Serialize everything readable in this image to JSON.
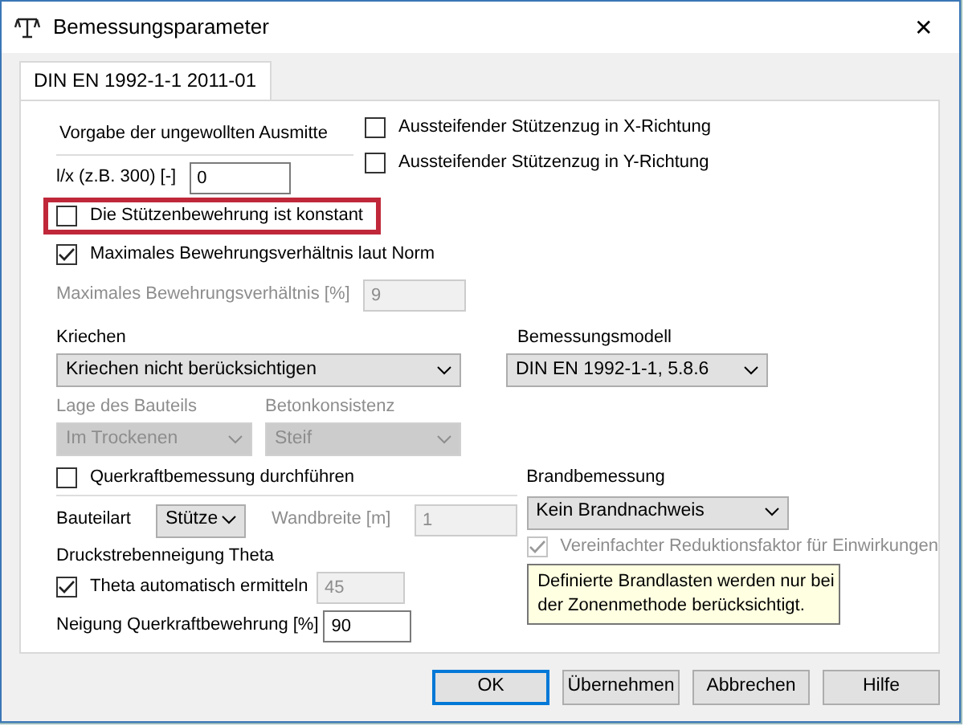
{
  "window": {
    "title": "Bemessungsparameter",
    "close": "✕"
  },
  "tabs": [
    {
      "label": "DIN EN 1992-1-1 2011-01",
      "selected": true
    }
  ],
  "ausmitte": {
    "heading": "Vorgabe der ungewollten Ausmitte",
    "label": "l/x (z.B. 300) [-]",
    "value": "0"
  },
  "stuetzenzug": [
    {
      "label": "Aussteifender Stützenzug in X-Richtung",
      "checked": false
    },
    {
      "label": "Aussteifender Stützenzug in Y-Richtung",
      "checked": false
    }
  ],
  "options": [
    {
      "label": "Die Stützenbewehrung ist konstant",
      "checked": false,
      "highlighted": true
    },
    {
      "label": "Maximales Bewehrungsverhältnis laut Norm",
      "checked": true,
      "highlighted": false
    }
  ],
  "max_ratio": {
    "label": "Maximales Bewehrungsverhältnis [%]",
    "value": "9",
    "disabled": true
  },
  "kriechen": {
    "label": "Kriechen",
    "value": "Kriechen nicht berücksichtigen",
    "disabled": false
  },
  "bemessungsmodell": {
    "label": "Bemessungsmodell",
    "value": "DIN EN 1992-1-1, 5.8.6",
    "disabled": false
  },
  "lage": {
    "label": "Lage des Bauteils",
    "value": "Im Trockenen",
    "disabled": true
  },
  "betonkonsistenz": {
    "label": "Betonkonsistenz",
    "value": "Steif",
    "disabled": true
  },
  "querkraft": {
    "label": "Querkraftbemessung durchführen",
    "checked": false,
    "bauteilart": {
      "label": "Bauteilart",
      "value": "Stütze",
      "disabled": false
    },
    "wandbreite": {
      "label": "Wandbreite [m]",
      "value": "1",
      "disabled": true
    },
    "theta_heading": "Druckstrebenneigung Theta",
    "theta_auto": {
      "label": "Theta automatisch ermitteln",
      "checked": true
    },
    "theta": {
      "value": "45",
      "disabled": true
    },
    "neigung": {
      "label": "Neigung Querkraftbewehrung [%]",
      "value": "90",
      "disabled": false
    }
  },
  "brand": {
    "label": "Brandbemessung",
    "value": "Kein Brandnachweis",
    "disabled": false,
    "reduktion": {
      "label": "Vereinfachter Reduktionsfaktor für Einwirkungen",
      "checked": true,
      "disabled": true
    },
    "tooltip": [
      "Definierte Brandlasten werden nur bei",
      "der Zonenmethode berücksichtigt."
    ]
  },
  "buttons": [
    {
      "label": "OK",
      "default": true
    },
    {
      "label": "Übernehmen",
      "default": false
    },
    {
      "label": "Abbrechen",
      "default": false
    },
    {
      "label": "Hilfe",
      "default": false
    }
  ]
}
